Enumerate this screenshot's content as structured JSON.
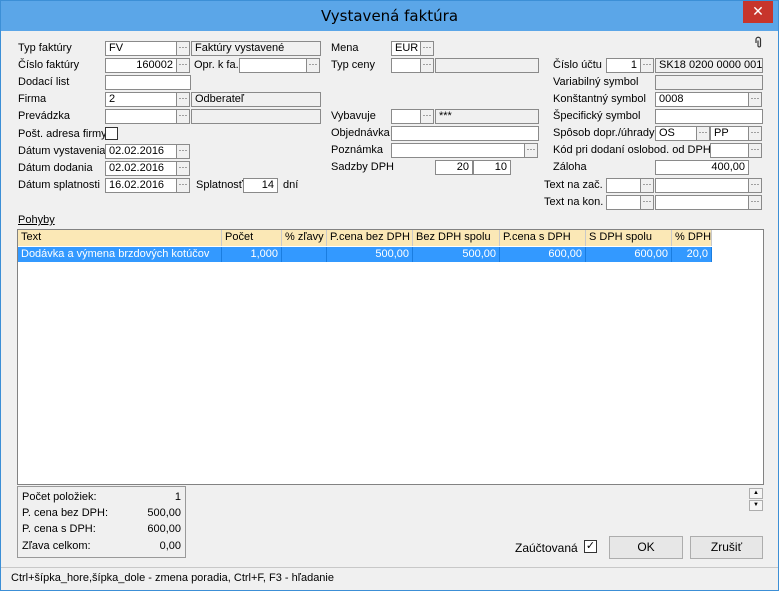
{
  "window": {
    "title": "Vystavená faktúra",
    "close": "✕"
  },
  "form": {
    "typ_faktury": {
      "label": "Typ faktúry",
      "value": "FV",
      "desc": "Faktúry vystavené"
    },
    "cislo_faktury": {
      "label": "Číslo faktúry",
      "value": "160002"
    },
    "opr_k_fa": {
      "label": "Opr. k fa.",
      "value": ""
    },
    "dodaci_list": {
      "label": "Dodací list",
      "value": ""
    },
    "firma": {
      "label": "Firma",
      "value": "2",
      "desc": "Odberateľ"
    },
    "prevadzka": {
      "label": "Prevádzka",
      "value": ""
    },
    "post_adresa": {
      "label": "Pošt. adresa firmy"
    },
    "datum_vystavenia": {
      "label": "Dátum vystavenia",
      "value": "02.02.2016"
    },
    "datum_dodania": {
      "label": "Dátum dodania",
      "value": "02.02.2016"
    },
    "datum_splatnosti": {
      "label": "Dátum splatnosti",
      "value": "16.02.2016"
    },
    "splatnost": {
      "label": "Splatnosť",
      "value": "14",
      "unit": "dní"
    },
    "mena": {
      "label": "Mena",
      "value": "EUR"
    },
    "typ_ceny": {
      "label": "Typ ceny",
      "value": ""
    },
    "vybavuje": {
      "label": "Vybavuje",
      "value": "",
      "desc": "***"
    },
    "objednavka": {
      "label": "Objednávka",
      "value": ""
    },
    "poznamka": {
      "label": "Poznámka",
      "value": ""
    },
    "sadzby_dph": {
      "label": "Sadzby DPH",
      "value1": "20",
      "value2": "10"
    },
    "cislo_uctu": {
      "label": "Číslo účtu",
      "value": "1",
      "desc": "SK18 0200 0000 001"
    },
    "variabilny_symbol": {
      "label": "Variabilný symbol",
      "value": ""
    },
    "konstantny_symbol": {
      "label": "Konštantný symbol",
      "value": "0008"
    },
    "specificky_symbol": {
      "label": "Špecifický symbol",
      "value": ""
    },
    "sposob_dopr": {
      "label": "Spôsob dopr./úhrady",
      "value1": "OS",
      "value2": "PP"
    },
    "kod_oslobod": {
      "label": "Kód pri dodaní oslobod. od DPH",
      "value": ""
    },
    "zaloha": {
      "label": "Záloha",
      "value": "400,00"
    },
    "text_na_zac": {
      "label": "Text na zač.",
      "value": ""
    },
    "text_na_kon": {
      "label": "Text na kon.",
      "value": ""
    },
    "ellipsis": "···"
  },
  "pohyby": {
    "label": "Pohyby",
    "columns": [
      "Text",
      "Počet",
      "% zľavy",
      "P.cena bez DPH",
      "Bez DPH spolu",
      "P.cena s DPH",
      "S DPH spolu",
      "% DPH"
    ],
    "rows": [
      [
        "Dodávka a výmena brzdových kotúčov",
        "1,000",
        "",
        "500,00",
        "500,00",
        "600,00",
        "600,00",
        "20,0"
      ]
    ]
  },
  "summary": {
    "pocet_poloziek": {
      "label": "Počet položiek:",
      "value": "1"
    },
    "p_cena_bez_dph": {
      "label": "P. cena bez DPH:",
      "value": "500,00"
    },
    "p_cena_s_dph": {
      "label": "P. cena s DPH:",
      "value": "600,00"
    },
    "zlava_celkom": {
      "label": "Zľava celkom:",
      "value": "0,00"
    }
  },
  "zauctovana": {
    "label": "Zaúčtovaná",
    "checked": true,
    "mark": "✓"
  },
  "buttons": {
    "ok": "OK",
    "zrusit": "Zrušiť"
  },
  "status": "Ctrl+šípka_hore,šípka_dole - zmena poradia, Ctrl+F, F3 - hľadanie",
  "icons": {
    "attach": "attachment-icon",
    "spin_up": "▲",
    "spin_down": "▼"
  }
}
